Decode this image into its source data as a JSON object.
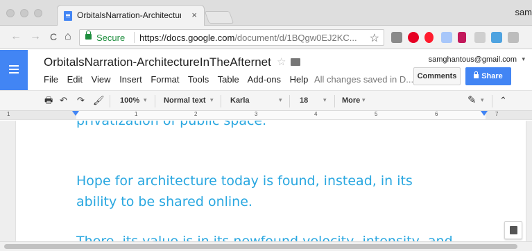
{
  "browser": {
    "tab_title": "OrbitalsNarration-Architecture",
    "tab_close": "×",
    "profile_name": "sam",
    "secure_label": "Secure",
    "url_host": "https://docs.google.com",
    "url_path": "/document/d/1BQgw0EJ2KC...",
    "bookmark_star": "☆",
    "nav_back": "←",
    "nav_forward": "→",
    "nav_reload": "C",
    "nav_home": "⌂",
    "extension_icons": [
      "extension-icon",
      "pinterest-icon",
      "opera-icon",
      "docs-icon",
      "chart-icon",
      "drive-icon",
      "photo-icon",
      "camera-icon"
    ]
  },
  "docs": {
    "title": "OrbitalsNarration-ArchitectureInTheAfternet",
    "title_star": "☆",
    "account_email": "samghantous@gmail.com",
    "account_caret": "▾",
    "menus": [
      "File",
      "Edit",
      "View",
      "Insert",
      "Format",
      "Tools",
      "Table",
      "Add-ons",
      "Help"
    ],
    "save_status": "All changes saved in D...",
    "comments_label": "Comments",
    "share_label": "Share"
  },
  "toolbar": {
    "print_icon": "🖶",
    "undo_icon": "↶",
    "redo_icon": "↷",
    "paint_icon": "🖌",
    "zoom": "100%",
    "style": "Normal text",
    "font": "Karla",
    "font_size": "18",
    "more": "More",
    "caret": "▾",
    "pen_icon": "✎",
    "collapse_icon": "⌃"
  },
  "ruler": {
    "numbers": [
      "1",
      "1",
      "2",
      "3",
      "4",
      "5",
      "6",
      "7"
    ]
  },
  "document": {
    "text_color": "#29a7e0",
    "paragraph_top_partial": "privatization of public space.",
    "paragraph_line_1": "Hope for architecture today is found, instead, in its",
    "paragraph_line_2": "ability to be shared online.",
    "paragraph_bottom_partial": "There, its value is in its newfound velocity, intensity, and"
  }
}
